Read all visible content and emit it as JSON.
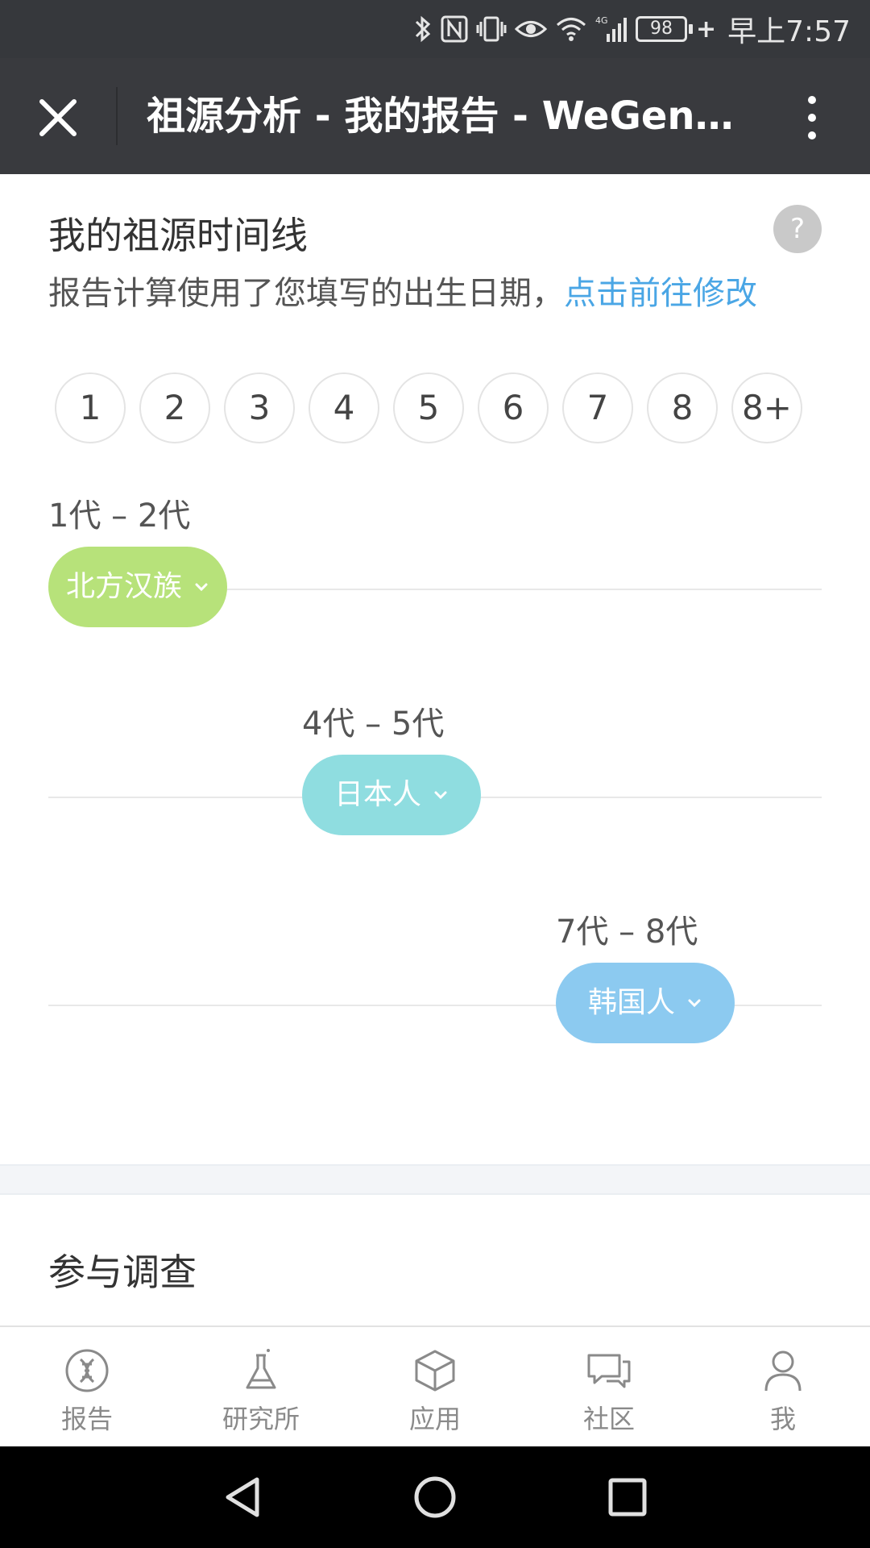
{
  "status_bar": {
    "battery": "98",
    "time": "早上7:57",
    "icons": [
      "bluetooth-icon",
      "nfc-icon",
      "vibrate-icon",
      "eye-icon",
      "wifi-icon",
      "signal-4g-icon",
      "battery-icon"
    ]
  },
  "title_bar": {
    "title": "祖源分析 - 我的报告 - WeGen…",
    "close_icon": "close-icon",
    "more_icon": "more-vertical-icon"
  },
  "timeline_section": {
    "title": "我的祖源时间线",
    "help": "?",
    "subtitle_text": "报告计算使用了您填写的出生日期，",
    "subtitle_link": "点击前往修改",
    "generations": [
      "1",
      "2",
      "3",
      "4",
      "5",
      "6",
      "7",
      "8",
      "8+"
    ],
    "entries": [
      {
        "range": "1代 – 2代",
        "label": "北方汉族",
        "color": "#b7e27a"
      },
      {
        "range": "4代 – 5代",
        "label": "日本人",
        "color": "#8fdde0"
      },
      {
        "range": "7代 – 8代",
        "label": "韩国人",
        "color": "#8ccaf0"
      }
    ]
  },
  "survey_section": {
    "title": "参与调查"
  },
  "tab_bar": {
    "tabs": [
      {
        "label": "报告",
        "icon": "dna-icon"
      },
      {
        "label": "研究所",
        "icon": "flask-icon"
      },
      {
        "label": "应用",
        "icon": "cube-icon"
      },
      {
        "label": "社区",
        "icon": "chat-icon"
      },
      {
        "label": "我",
        "icon": "person-icon"
      }
    ]
  },
  "nav_bar": {
    "icons": [
      "back-triangle-icon",
      "home-circle-icon",
      "recents-square-icon"
    ]
  }
}
